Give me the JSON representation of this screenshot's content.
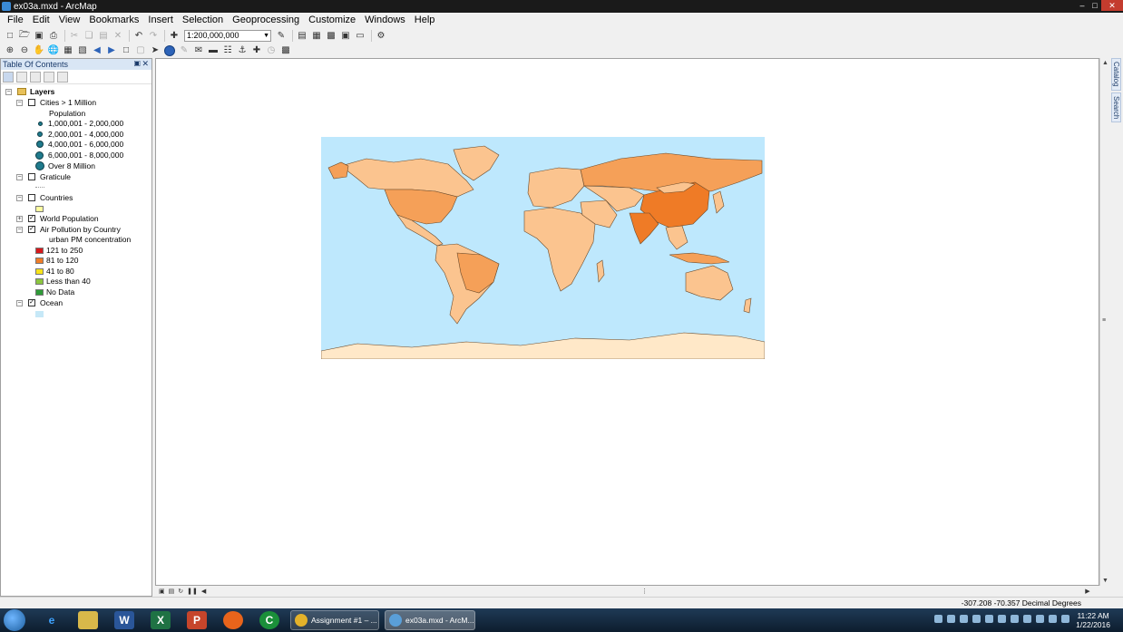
{
  "window": {
    "title": "ex03a.mxd - ArcMap",
    "min": "–",
    "max": "□",
    "close": "✕"
  },
  "menu": [
    "File",
    "Edit",
    "View",
    "Bookmarks",
    "Insert",
    "Selection",
    "Geoprocessing",
    "Customize",
    "Windows",
    "Help"
  ],
  "toolbar": {
    "scale": "1:200,000,000"
  },
  "toc": {
    "title": "Table Of Contents",
    "pin": "▣",
    "close": "✕",
    "layers_label": "Layers",
    "cities": {
      "name": "Cities > 1 Million",
      "field": "Population",
      "classes": [
        "1,000,001 - 2,000,000",
        "2,000,001 - 4,000,000",
        "4,000,001 - 6,000,000",
        "6,000,001 - 8,000,000",
        "Over 8 Million"
      ]
    },
    "graticule": {
      "name": "Graticule"
    },
    "countries": {
      "name": "Countries"
    },
    "world_population": {
      "name": "World Population"
    },
    "air_pollution": {
      "name": "Air Pollution by Country",
      "field": "urban PM concentration",
      "classes": [
        {
          "label": "121 to 250",
          "color": "#d7191c"
        },
        {
          "label": "81 to 120",
          "color": "#f07d28"
        },
        {
          "label": "41 to 80",
          "color": "#f7e31a"
        },
        {
          "label": "Less than 40",
          "color": "#8bc53f"
        },
        {
          "label": "No Data",
          "color": "#2f9b38"
        }
      ]
    },
    "ocean": {
      "name": "Ocean"
    },
    "colors": {
      "countries": "#ffffa0",
      "ocean": "#c6e8f7"
    }
  },
  "map": {
    "ocean_color": "#bee8fd",
    "land_light": "#fbc48f",
    "land_mid": "#f5a058",
    "land_dark": "#ef7b26",
    "antarctica": "#ffe8c8"
  },
  "sidetabs": [
    "Catalog",
    "Search"
  ],
  "status": {
    "coords": "-307.208  -70.357 Decimal Degrees"
  },
  "taskbar": {
    "tasks": [
      "Assignment #1 – ...",
      "ex03a.mxd - ArcM..."
    ],
    "time": "11:22 AM",
    "date": "1/22/2016"
  }
}
